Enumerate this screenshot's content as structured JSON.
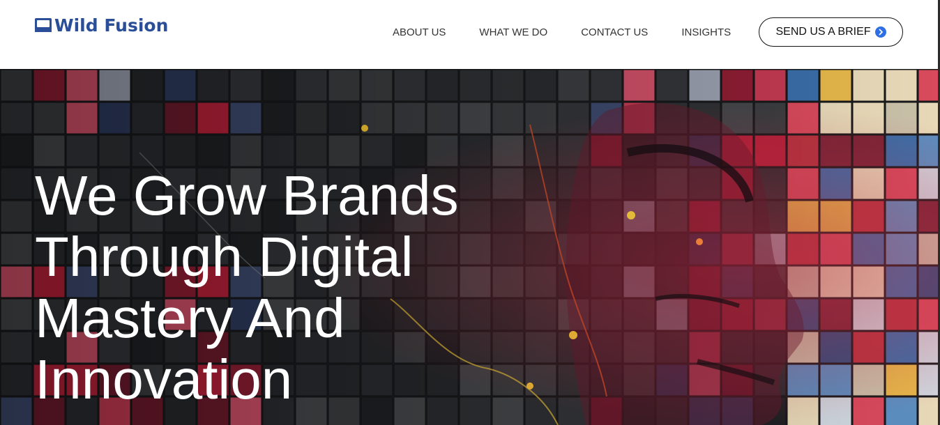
{
  "brand": {
    "name": "Wild Fusion",
    "color": "#2a4e98",
    "logo_icon": "monitor-icon"
  },
  "nav": {
    "items": [
      {
        "label": "ABOUT US"
      },
      {
        "label": "WHAT WE DO"
      },
      {
        "label": "CONTACT US"
      },
      {
        "label": "INSIGHTS"
      }
    ]
  },
  "cta": {
    "label": "SEND US A BRIEF",
    "icon": "arrow-circle-icon",
    "icon_color": "#2f6fe4"
  },
  "hero": {
    "headline_lines": [
      "We Grow Brands",
      "Through Digital",
      "Mastery And",
      "Innovation"
    ],
    "background": "mosaic-portrait-image"
  }
}
